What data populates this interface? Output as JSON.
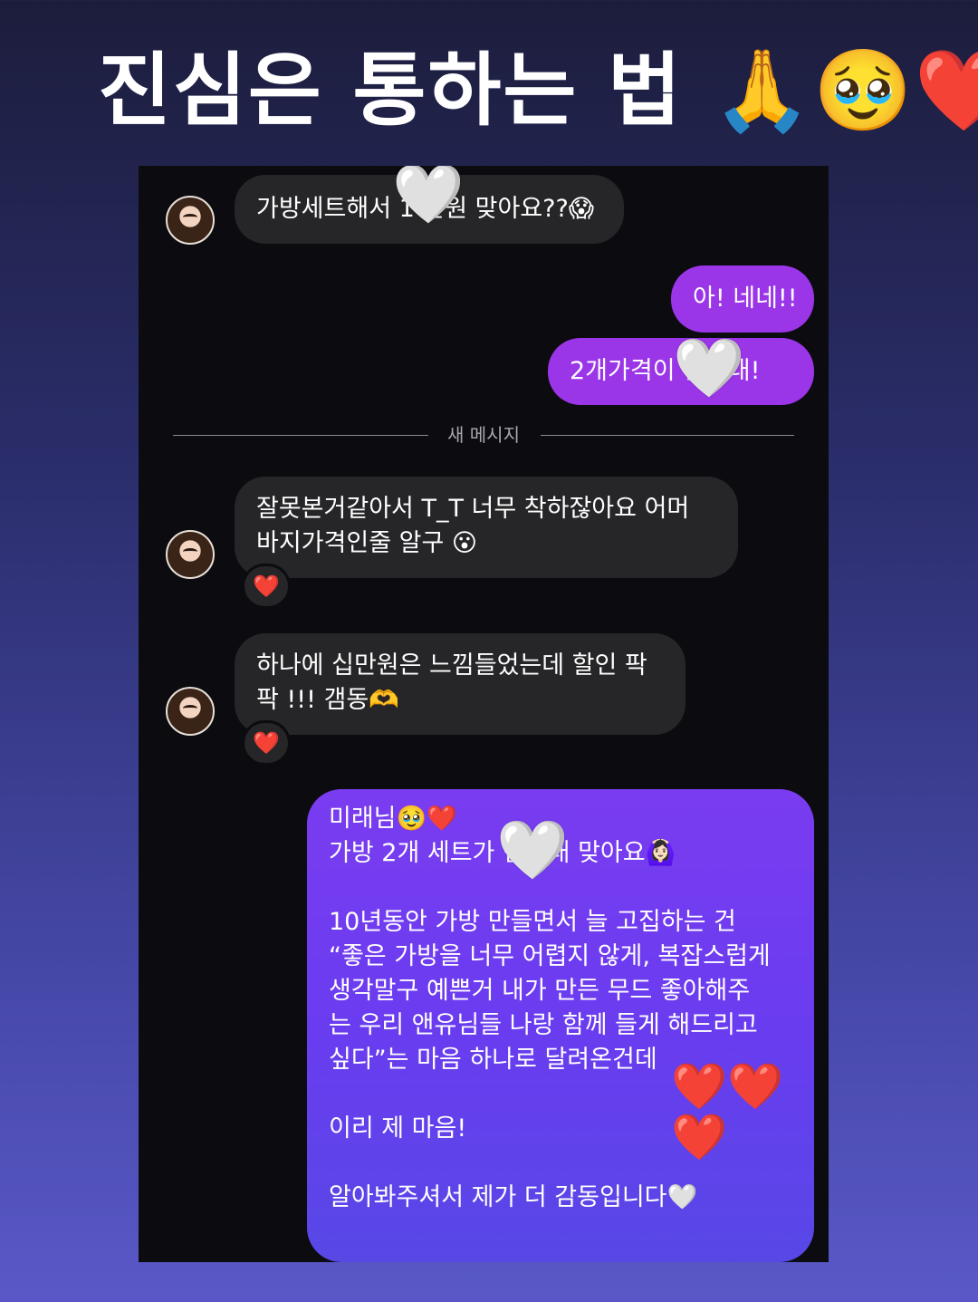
{
  "headline": {
    "text": "진심은 통하는 법",
    "emojis": "🙏🥹❤️"
  },
  "chat": {
    "messages": [
      {
        "from": "them",
        "text": "가방세트해서 1 만원 맞아요??😱"
      },
      {
        "from": "me",
        "text": "아! 네네!!"
      },
      {
        "from": "me",
        "text": "2개가격이 만원대!"
      },
      {
        "from": "them",
        "line1": "잘못본거같아서 T_T 너무 착하잖아요 어머",
        "line2": "바지가격인줄 알구 😮",
        "reaction": "❤️"
      },
      {
        "from": "them",
        "line1": "하나에 십만원은 느낌들었는데 할인 팍",
        "line2": "팍 !!! 갬동🫶",
        "reaction": "❤️"
      },
      {
        "from": "me",
        "lines": [
          "미래님🥹❤️",
          "가방 2개 세트가 만원대 맞아요🙆🏻‍♀️",
          "",
          "10년동안 가방 만들면서 늘 고집하는 건",
          "“좋은 가방을 너무 어렵지 않게, 복잡스럽게",
          "생각말구 예쁜거 내가 만든 무드 좋아해주",
          "는 우리 앤유님들 나랑 함께 들게 해드리고",
          "싶다”는 마음 하나로 달려온건데",
          "",
          "이리 제 마음!",
          "",
          "알아봐주셔서 제가 더 감동입니다🤍"
        ]
      }
    ],
    "divider": "새 메시지",
    "sticker_glyph": "🤍",
    "big_hearts": "❤️❤️❤️"
  },
  "colors": {
    "outgoing": "#9b35e8",
    "incoming": "#262628",
    "background": "#0b0b10"
  }
}
